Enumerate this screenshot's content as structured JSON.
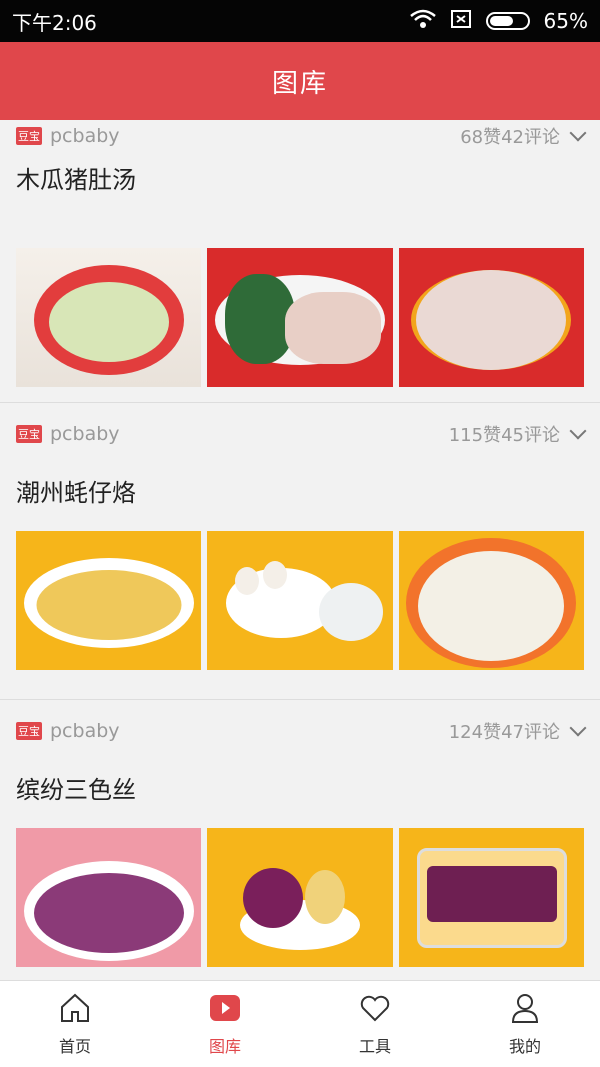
{
  "status": {
    "time": "下午2:06",
    "battery": "65%"
  },
  "header": {
    "title": "图库"
  },
  "posts": [
    {
      "author": "pcbaby",
      "stats": "68赞42评论",
      "title": "木瓜猪肚汤"
    },
    {
      "author": "pcbaby",
      "stats": "115赞45评论",
      "title": "潮州蚝仔烙"
    },
    {
      "author": "pcbaby",
      "stats": "124赞47评论",
      "title": "缤纷三色丝"
    }
  ],
  "logo_text": "豆宝",
  "tabs": [
    {
      "label": "首页",
      "icon": "home-icon"
    },
    {
      "label": "图库",
      "icon": "gallery-icon"
    },
    {
      "label": "工具",
      "icon": "heart-icon"
    },
    {
      "label": "我的",
      "icon": "profile-icon"
    }
  ],
  "colors": {
    "accent": "#e0474b"
  }
}
